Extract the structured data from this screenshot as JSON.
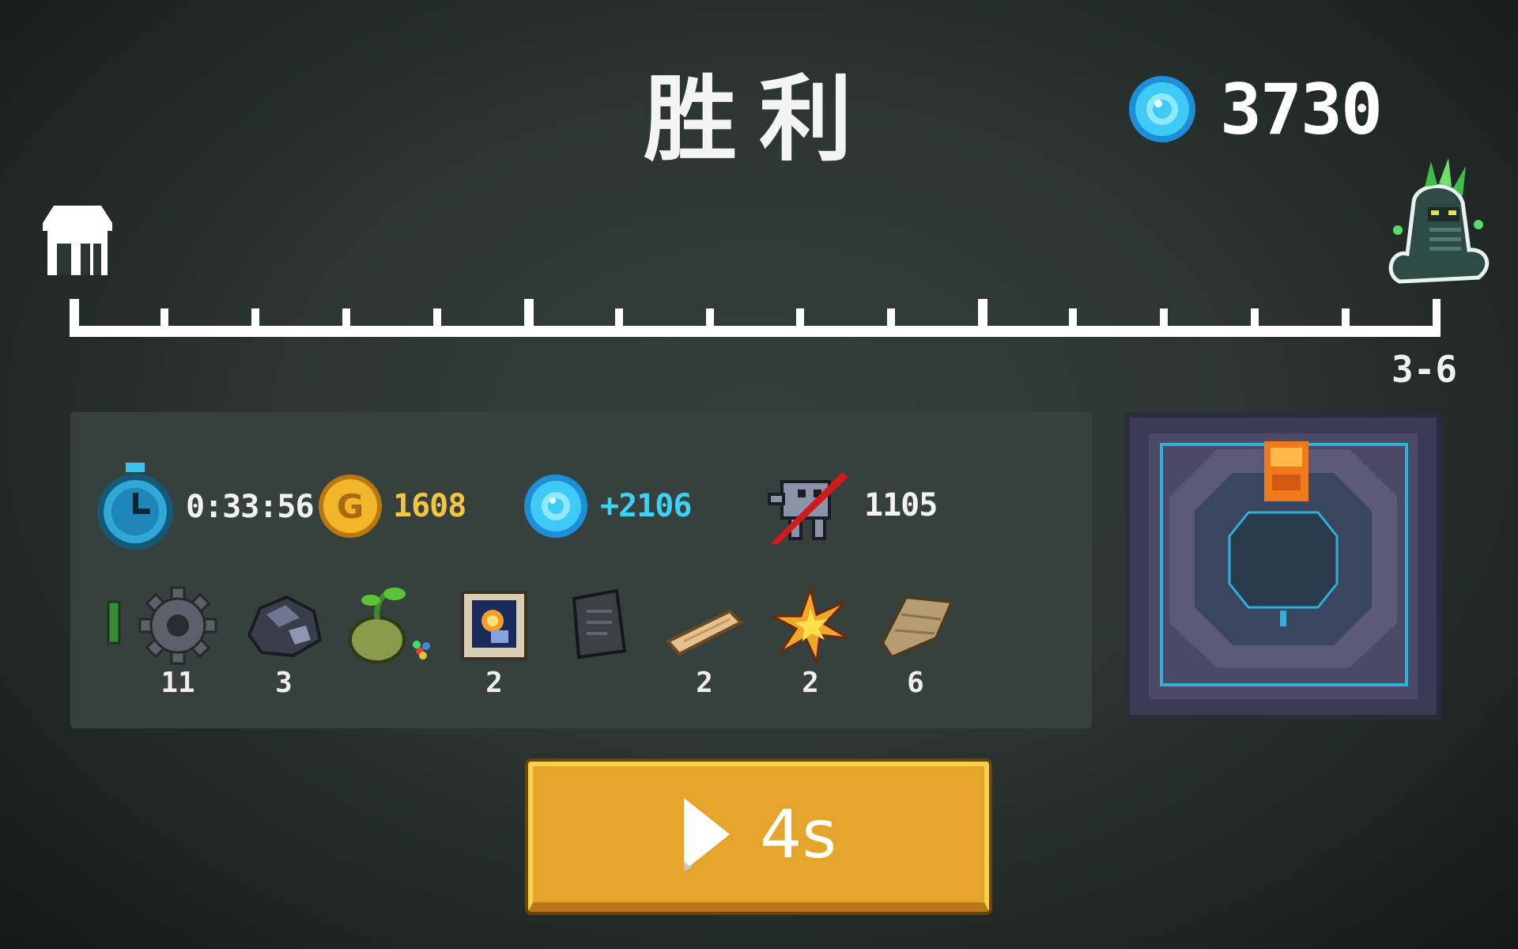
{
  "screen": {
    "title": "胜利"
  },
  "currency": {
    "gems_total": "3730",
    "icon": "blue-gem-icon"
  },
  "progress": {
    "start_icon": "home-icon",
    "end_icon": "boss-serpent-icon",
    "stage": "3-6",
    "progress_fraction": 1.0
  },
  "stats": {
    "time": "0:33:56",
    "gold": "1608",
    "gems_earned": "+2106",
    "kills": "1105"
  },
  "items": [
    {
      "icon": "green-bar-icon",
      "count": ""
    },
    {
      "icon": "gear-icon",
      "count": "11"
    },
    {
      "icon": "ore-icon",
      "count": "3"
    },
    {
      "icon": "seed-sprout-icon",
      "count": ""
    },
    {
      "icon": "scroll-icon",
      "count": "2"
    },
    {
      "icon": "dark-tablet-icon",
      "count": ""
    },
    {
      "icon": "wood-plank-icon",
      "count": "2"
    },
    {
      "icon": "explosion-icon",
      "count": "2"
    },
    {
      "icon": "cloth-icon",
      "count": "6"
    }
  ],
  "continue_button": {
    "label": "4s",
    "icon": "play-icon"
  },
  "colors": {
    "gold": "#f5c542",
    "gem": "#3fd0f5",
    "button": "#e4a52a"
  }
}
